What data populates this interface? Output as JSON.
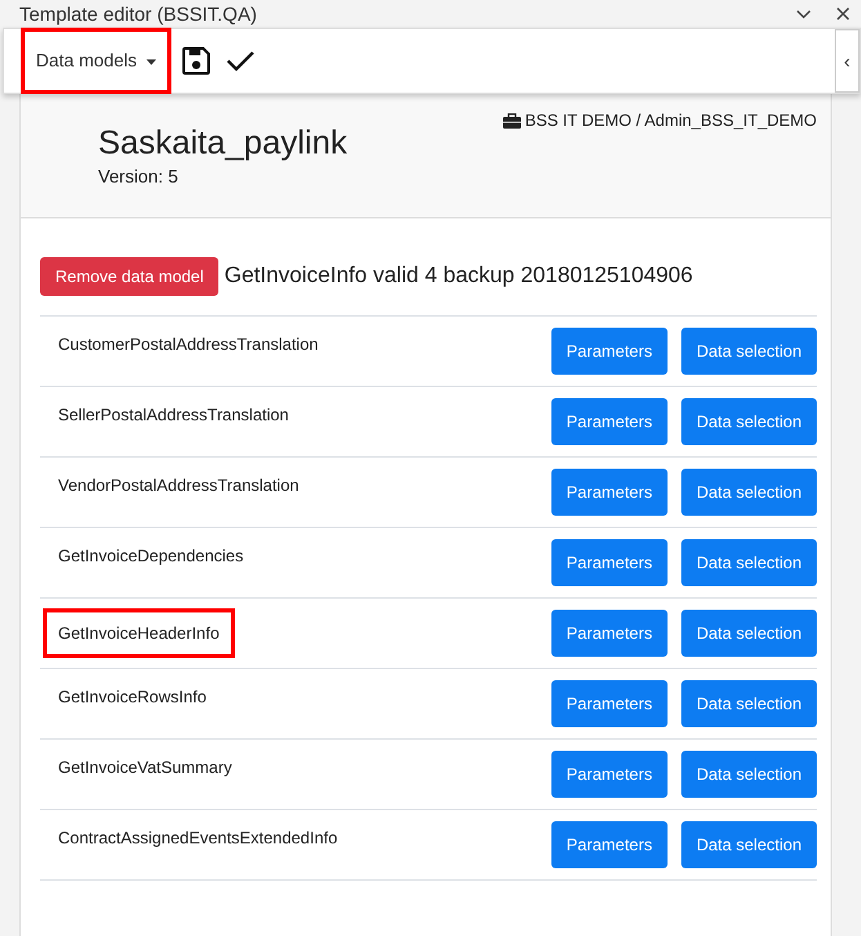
{
  "window": {
    "title": "Template editor (BSSIT.QA)"
  },
  "toolbar": {
    "dropdown": {
      "label": "Data models",
      "highlighted": true
    },
    "collapse": "‹"
  },
  "header": {
    "title": "Saskaita_paylink",
    "version": "Version: 5",
    "account": "BSS IT DEMO / Admin_BSS_IT_DEMO"
  },
  "data_model": {
    "remove_button": "Remove data model",
    "name": "GetInvoiceInfo valid 4 backup 20180125104906"
  },
  "rows": [
    {
      "name": "CustomerPostalAddressTranslation",
      "highlighted": false,
      "buttons": [
        "Parameters",
        "Data selection"
      ]
    },
    {
      "name": "SellerPostalAddressTranslation",
      "highlighted": false,
      "buttons": [
        "Parameters",
        "Data selection"
      ]
    },
    {
      "name": "VendorPostalAddressTranslation",
      "highlighted": false,
      "buttons": [
        "Parameters",
        "Data selection"
      ]
    },
    {
      "name": "GetInvoiceDependencies",
      "highlighted": false,
      "buttons": [
        "Parameters",
        "Data selection"
      ]
    },
    {
      "name": "GetInvoiceHeaderInfo",
      "highlighted": true,
      "buttons": [
        "Parameters",
        "Data selection"
      ]
    },
    {
      "name": "GetInvoiceRowsInfo",
      "highlighted": false,
      "buttons": [
        "Parameters",
        "Data selection"
      ]
    },
    {
      "name": "GetInvoiceVatSummary",
      "highlighted": false,
      "buttons": [
        "Parameters",
        "Data selection"
      ]
    },
    {
      "name": "ContractAssignedEventsExtendedInfo",
      "highlighted": false,
      "buttons": [
        "Parameters",
        "Data selection"
      ]
    }
  ]
}
